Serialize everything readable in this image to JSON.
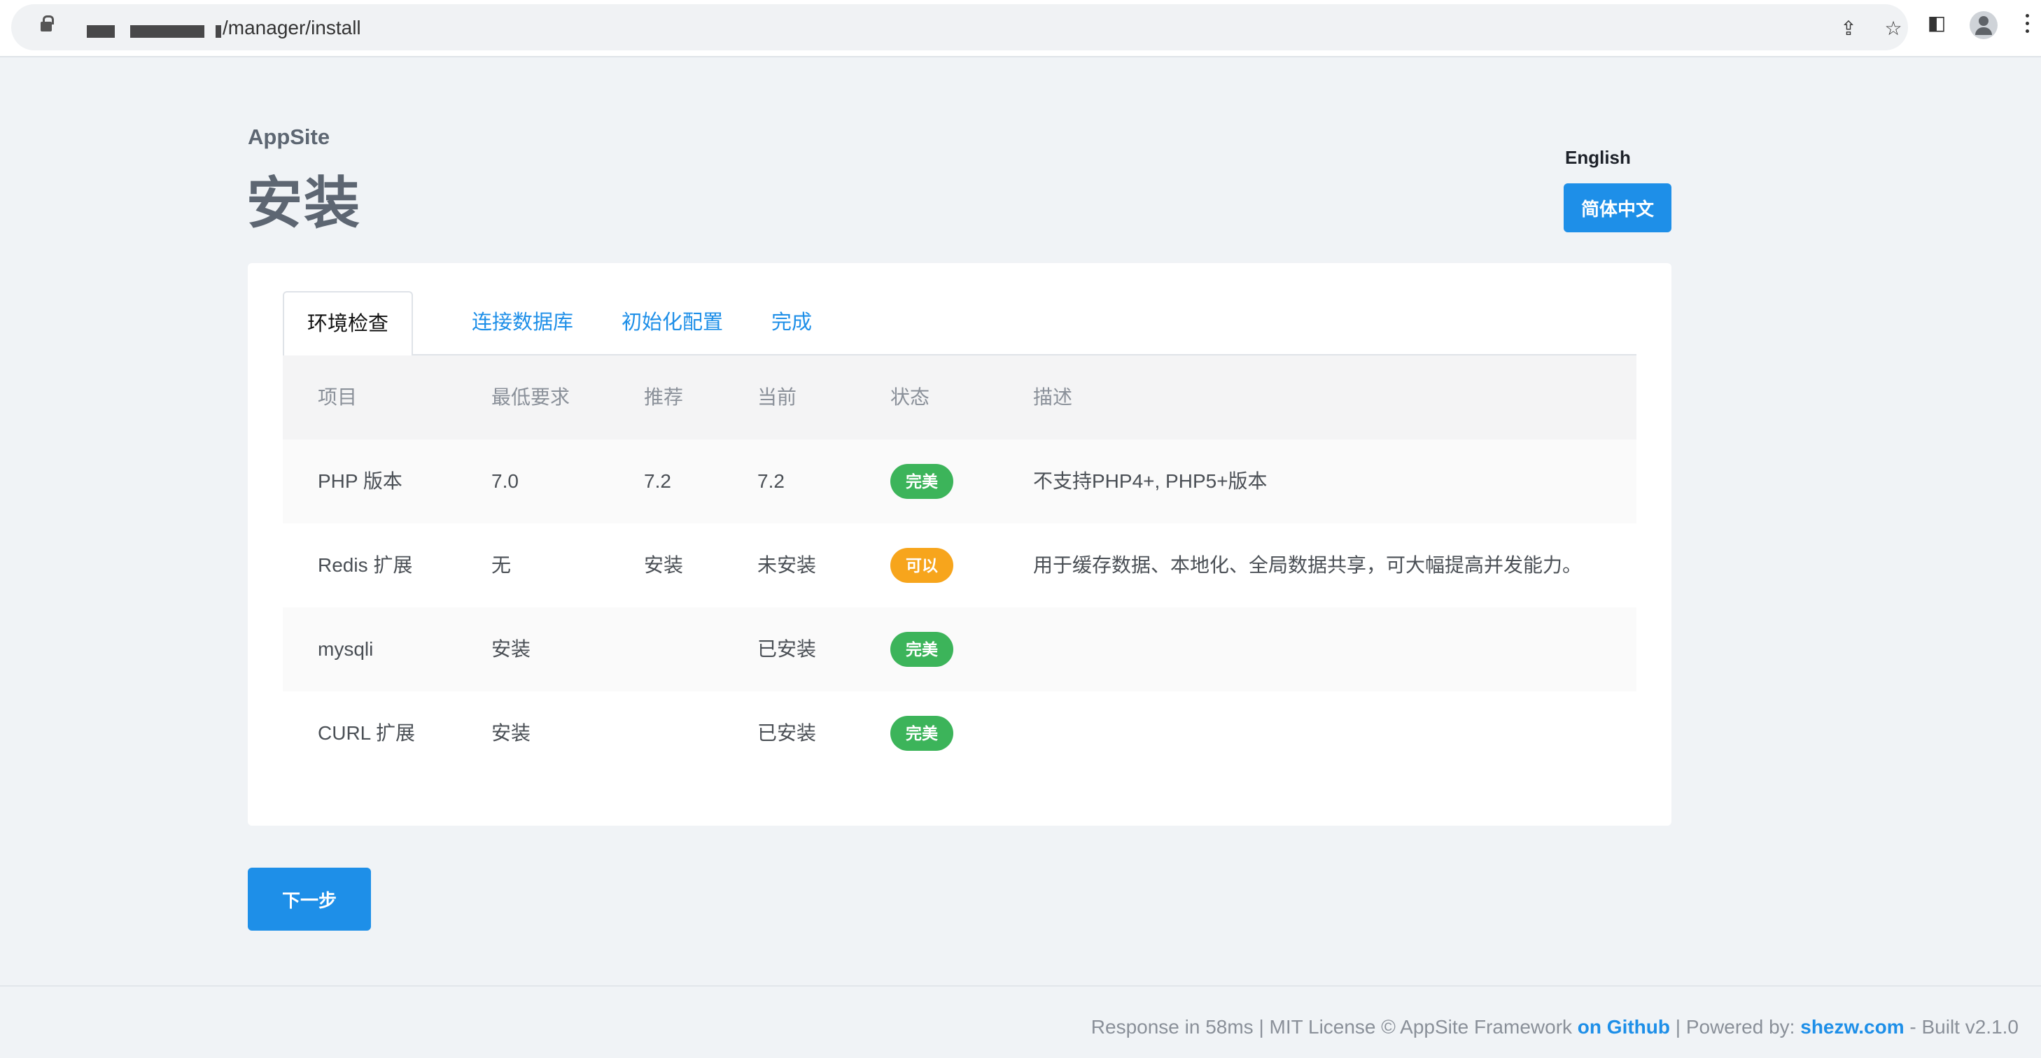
{
  "browser": {
    "url": "/manager/install"
  },
  "header": {
    "brand": "AppSite",
    "title": "安装",
    "lang_english": "English",
    "lang_chinese": "简体中文"
  },
  "tabs": [
    {
      "label": "环境检查",
      "active": true
    },
    {
      "label": "连接数据库",
      "active": false
    },
    {
      "label": "初始化配置",
      "active": false
    },
    {
      "label": "完成",
      "active": false
    }
  ],
  "table": {
    "columns": [
      "项目",
      "最低要求",
      "推荐",
      "当前",
      "状态",
      "描述"
    ],
    "rows": [
      {
        "item": "PHP 版本",
        "min": "7.0",
        "recommended": "7.2",
        "current": "7.2",
        "status": "完美",
        "status_color": "#3cb45a",
        "desc": "不支持PHP4+, PHP5+版本"
      },
      {
        "item": "Redis 扩展",
        "min": "无",
        "recommended": "安装",
        "current": "未安装",
        "status": "可以",
        "status_color": "#f7a51c",
        "desc": "用于缓存数据、本地化、全局数据共享，可大幅提高并发能力。"
      },
      {
        "item": "mysqli",
        "min": "安装",
        "recommended": "",
        "current": "已安装",
        "status": "完美",
        "status_color": "#3cb45a",
        "desc": ""
      },
      {
        "item": "CURL 扩展",
        "min": "安装",
        "recommended": "",
        "current": "已安装",
        "status": "完美",
        "status_color": "#3cb45a",
        "desc": ""
      }
    ]
  },
  "next_button": "下一步",
  "footer": {
    "text_1": "Response in 58ms | MIT License © AppSite Framework ",
    "link_github": "on Github",
    "text_2": " | Powered by: ",
    "link_site": "shezw.com",
    "text_3": " - Built v2.1.0"
  },
  "colors": {
    "accent": "#1e8fe8",
    "success": "#3cb45a",
    "warning": "#f7a51c"
  }
}
